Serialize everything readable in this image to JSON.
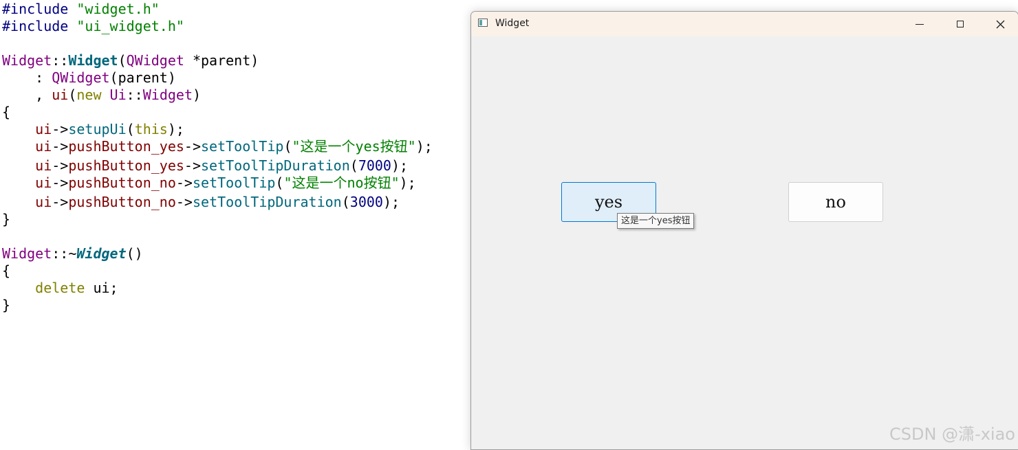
{
  "code": {
    "include1_directive": "#include",
    "include1_file": "\"widget.h\"",
    "include2_directive": "#include",
    "include2_file": "\"ui_widget.h\"",
    "ctor_class": "Widget",
    "ctor_sep": "::",
    "ctor_name": "Widget",
    "ctor_params_open": "(",
    "ctor_param_type": "QWidget",
    "ctor_param_name": " *parent)",
    "init1_prefix": "    : ",
    "init1_type": "QWidget",
    "init1_rest": "(parent)",
    "init2_prefix": "    , ",
    "init2_member": "ui",
    "init2_open": "(",
    "init2_new": "new",
    "init2_ns": " Ui",
    "init2_sep": "::",
    "init2_type": "Widget",
    "init2_close": ")",
    "brace_open": "{",
    "setup_obj": "    ui",
    "setup_arrow": "->",
    "setup_fn": "setupUi",
    "setup_open": "(",
    "setup_this": "this",
    "setup_close": ");",
    "l1_obj": "    ui",
    "l1_arrow1": "->",
    "l1_member": "pushButton_yes",
    "l1_arrow2": "->",
    "l1_fn": "setToolTip",
    "l1_open": "(",
    "l1_str": "\"这是一个yes按钮\"",
    "l1_close": ");",
    "l2_obj": "    ui",
    "l2_arrow1": "->",
    "l2_member": "pushButton_yes",
    "l2_arrow2": "->",
    "l2_fn": "setToolTipDuration",
    "l2_open": "(",
    "l2_num": "7000",
    "l2_close": ");",
    "l3_obj": "    ui",
    "l3_arrow1": "->",
    "l3_member": "pushButton_no",
    "l3_arrow2": "->",
    "l3_fn": "setToolTip",
    "l3_open": "(",
    "l3_str": "\"这是一个no按钮\"",
    "l3_close": ");",
    "l4_obj": "    ui",
    "l4_arrow1": "->",
    "l4_member": "pushButton_no",
    "l4_arrow2": "->",
    "l4_fn": "setToolTipDuration",
    "l4_open": "(",
    "l4_num": "3000",
    "l4_close": ");",
    "brace_close": "}",
    "dtor_class": "Widget",
    "dtor_sep": "::~",
    "dtor_name": "Widget",
    "dtor_parens": "()",
    "brace_open2": "{",
    "delete_kw": "    delete",
    "delete_rest": " ui;",
    "brace_close2": "}"
  },
  "window": {
    "title": "Widget",
    "yes_button": "yes",
    "no_button": "no",
    "tooltip": "这是一个yes按钮",
    "icons": [
      "app-window-icon",
      "minimize-icon",
      "maximize-icon",
      "close-icon"
    ]
  },
  "watermark": "CSDN @潇-xiao"
}
